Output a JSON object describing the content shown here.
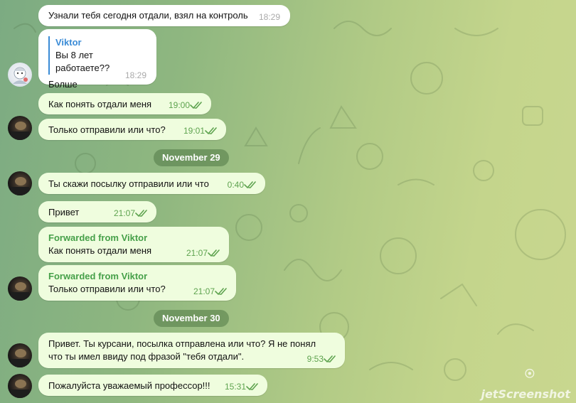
{
  "messages": [
    {
      "text": "Узнали тебя сегодня отдали, взял на контроль",
      "time": "18:29"
    },
    {
      "reply_name": "Viktor",
      "reply_text": "Вы 8 лет работаете??",
      "text": "Болше",
      "time": "18:29"
    },
    {
      "text": "Как понять отдали меня",
      "time": "19:00"
    },
    {
      "text": "Только отправили или что?",
      "time": "19:01"
    },
    {
      "text": "Ты скажи посылку отправили или что",
      "time": "0:40"
    },
    {
      "text": "Привет",
      "time": "21:07"
    },
    {
      "forward_label": "Forwarded from Viktor",
      "text": "Как понять отдали меня",
      "time": "21:07"
    },
    {
      "forward_label": "Forwarded from Viktor",
      "text": "Только отправили или что?",
      "time": "21:07"
    },
    {
      "text_line1": "Привет. Ты курсани, посылка отправлена или что? Я не понял",
      "text_line2": "что ты имел ввиду под фразой \"тебя отдали\".",
      "time": "9:53"
    },
    {
      "text": "Пожалуйста уважаемый профессор!!!",
      "time": "15:31"
    }
  ],
  "date_separators": [
    "November 29",
    "November 30"
  ],
  "watermark": "jetScreenshot",
  "colors": {
    "incoming": "#ffffff",
    "outgoing": "#effdde",
    "check": "#5ea34f",
    "forward": "#46a049",
    "reply": "#3a8bd6"
  }
}
